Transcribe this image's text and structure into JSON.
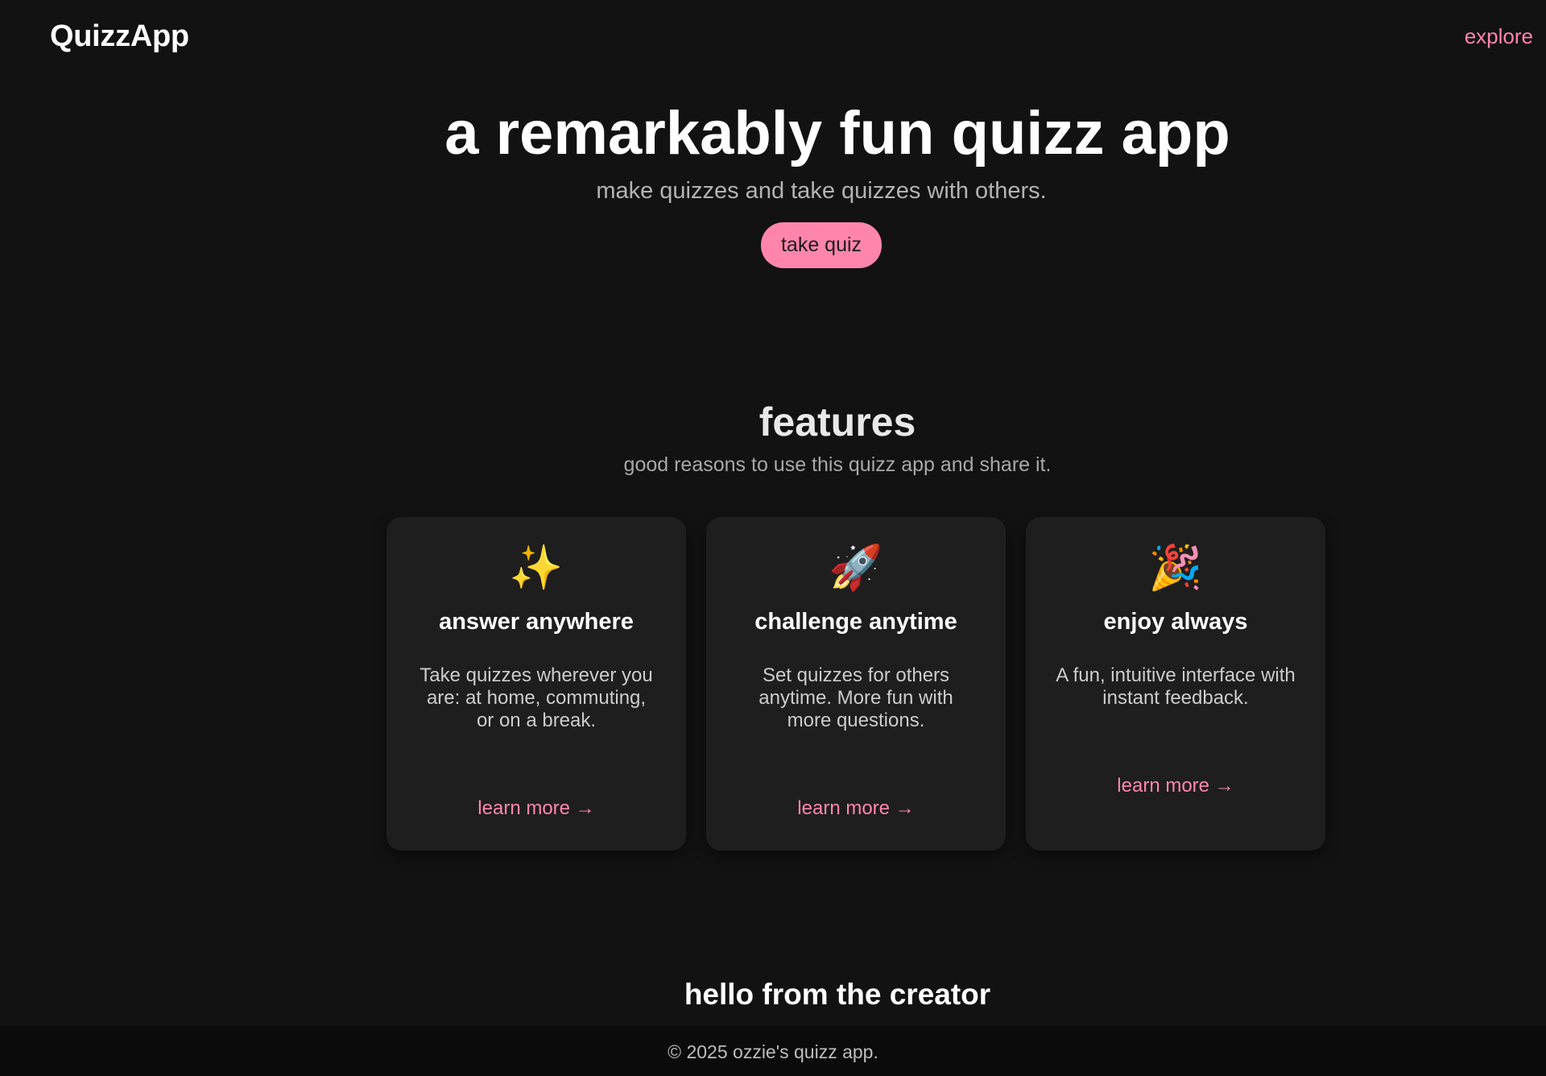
{
  "header": {
    "logo": "QuizzApp",
    "nav_link": "explore"
  },
  "hero": {
    "title": "a remarkably fun quizz app",
    "subtitle": "make quizzes and take quizzes with others.",
    "cta_label": "take quiz"
  },
  "features": {
    "title": "features",
    "subtitle": "good reasons to use this quizz app and share it.",
    "cards": [
      {
        "icon": "✨",
        "icon_name": "sparkles-icon",
        "title": "answer anywhere",
        "body": "Take quizzes wherever you are: at home, commuting, or on a break.",
        "link": "learn more →"
      },
      {
        "icon": "🚀",
        "icon_name": "rocket-icon",
        "title": "challenge anytime",
        "body": "Set quizzes for others anytime. More fun with more questions.",
        "link": "learn more →"
      },
      {
        "icon": "🎉",
        "icon_name": "party-popper-icon",
        "title": "enjoy always",
        "body": "A fun, intuitive interface with instant feedback.",
        "link": "learn more →"
      }
    ]
  },
  "creator": {
    "title": "hello from the creator"
  },
  "footer": {
    "text": "© 2025 ozzie's quizz app."
  },
  "colors": {
    "background": "#121212",
    "card": "#1e1e1e",
    "accent": "#ff85ad",
    "footer": "#0b0b0b"
  }
}
